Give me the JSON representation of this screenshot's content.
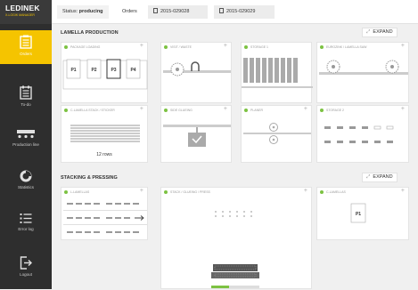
{
  "app": {
    "brand": "LEDINEK",
    "brand_sub": "X-LOGIK MANAGER"
  },
  "sidebar": {
    "items": [
      {
        "label": "Orders",
        "icon": "orders-icon"
      },
      {
        "label": "To-do",
        "icon": "todo-icon"
      },
      {
        "label": "Production line",
        "icon": "production-line-icon"
      },
      {
        "label": "Statistics",
        "icon": "statistics-icon"
      },
      {
        "label": "Error log",
        "icon": "error-log-icon"
      },
      {
        "label": "Logout",
        "icon": "logout-icon"
      }
    ]
  },
  "topbar": {
    "status_label": "Status:",
    "status_value": "producing",
    "orders_label": "Orders",
    "orders": [
      "2015-029028",
      "2015-029029"
    ]
  },
  "sections": {
    "lamella": {
      "title": "LAMELLA PRODUCTION",
      "expand": "EXPAND",
      "cards": [
        {
          "label": "PACKAGE LOADING",
          "packages": [
            "P1",
            "P2",
            "P3",
            "P4"
          ]
        },
        {
          "label": "VISIT / WASTE"
        },
        {
          "label": "STORAGE 1"
        },
        {
          "label": "EUROZINK / LAMELLA SAW"
        },
        {
          "label": "C-LAMELLA STACK / STICKER",
          "rows": "12 rows"
        },
        {
          "label": "SIDE GLUEING"
        },
        {
          "label": "PLANER"
        },
        {
          "label": "STORAGE 2"
        }
      ]
    },
    "stacking": {
      "title": "STACKING & PRESSING",
      "expand": "EXPAND",
      "cards": [
        {
          "label": "L-LAMELLAS"
        },
        {
          "label": "STACK / GLUEING / PRESS"
        },
        {
          "label": "C-LAMELLAS",
          "package": "P1"
        }
      ]
    }
  },
  "colors": {
    "accent": "#f5c400",
    "status_ok": "#7cc242",
    "sidebar": "#2e2e2e"
  }
}
